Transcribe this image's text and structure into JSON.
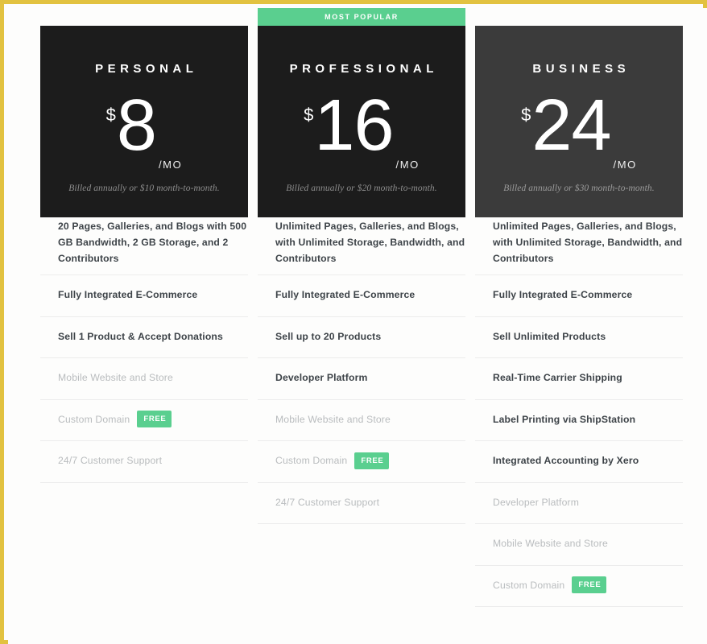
{
  "theme": {
    "accent_green": "#5ACF8F",
    "frame_gold": "#e2c240",
    "card_dark": "#1c1c1c",
    "card_dark_alt": "#3b3b3b",
    "page_background": "#fdfdfc"
  },
  "plans": [
    {
      "banner": null,
      "name": "PERSONAL",
      "currency": "$",
      "amount": "8",
      "period": "/MO",
      "billing_note": "Billed annually  or $10 month-to-month.",
      "card_style": "dark",
      "features": [
        {
          "label": "20 Pages, Galleries, and Blogs with 500 GB Bandwidth, 2 GB Storage, and 2 Contributors",
          "emphasis": "strong",
          "badge": null
        },
        {
          "label": "Fully Integrated E-Commerce",
          "emphasis": "strong",
          "badge": null
        },
        {
          "label": "Sell 1 Product & Accept Donations",
          "emphasis": "strong",
          "badge": null
        },
        {
          "label": "Mobile Website and Store",
          "emphasis": "muted",
          "badge": null
        },
        {
          "label": "Custom Domain",
          "emphasis": "muted",
          "badge": "FREE"
        },
        {
          "label": "24/7 Customer Support",
          "emphasis": "muted",
          "badge": null
        }
      ]
    },
    {
      "banner": "MOST POPULAR",
      "name": "PROFESSIONAL",
      "currency": "$",
      "amount": "16",
      "period": "/MO",
      "billing_note": "Billed annually  or $20 month-to-month.",
      "card_style": "dark",
      "features": [
        {
          "label": "Unlimited Pages, Galleries, and Blogs, with Unlimited Storage, Bandwidth, and Contributors",
          "emphasis": "strong",
          "badge": null
        },
        {
          "label": "Fully Integrated E-Commerce",
          "emphasis": "strong",
          "badge": null
        },
        {
          "label": "Sell up to 20 Products",
          "emphasis": "strong",
          "badge": null
        },
        {
          "label": "Developer Platform",
          "emphasis": "strong",
          "badge": null
        },
        {
          "label": "Mobile Website and Store",
          "emphasis": "muted",
          "badge": null
        },
        {
          "label": "Custom Domain",
          "emphasis": "muted",
          "badge": "FREE"
        },
        {
          "label": "24/7 Customer Support",
          "emphasis": "muted",
          "badge": null
        }
      ]
    },
    {
      "banner": null,
      "name": "BUSINESS",
      "currency": "$",
      "amount": "24",
      "period": "/MO",
      "billing_note": "Billed annually  or $30 month-to-month.",
      "card_style": "dark2",
      "features": [
        {
          "label": "Unlimited Pages, Galleries, and Blogs, with Unlimited Storage, Bandwidth, and Contributors",
          "emphasis": "strong",
          "badge": null
        },
        {
          "label": "Fully Integrated E-Commerce",
          "emphasis": "strong",
          "badge": null
        },
        {
          "label": "Sell Unlimited Products",
          "emphasis": "strong",
          "badge": null
        },
        {
          "label": "Real-Time Carrier Shipping",
          "emphasis": "strong",
          "badge": null
        },
        {
          "label": "Label Printing via ShipStation",
          "emphasis": "strong",
          "badge": null
        },
        {
          "label": "Integrated Accounting by Xero",
          "emphasis": "strong",
          "badge": null
        },
        {
          "label": "Developer Platform",
          "emphasis": "muted",
          "badge": null
        },
        {
          "label": "Mobile Website and Store",
          "emphasis": "muted",
          "badge": null
        },
        {
          "label": "Custom Domain",
          "emphasis": "muted",
          "badge": "FREE"
        }
      ]
    }
  ]
}
